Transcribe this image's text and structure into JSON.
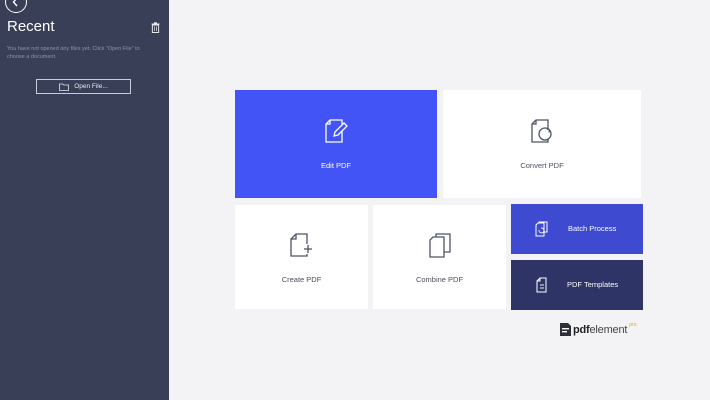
{
  "sidebar": {
    "title": "Recent",
    "empty_message": "You have not opened any files yet. Click \"Open File\" to choose a document.",
    "open_file_label": "Open File..."
  },
  "tiles": {
    "edit": "Edit PDF",
    "convert": "Convert PDF",
    "create": "Create PDF",
    "combine": "Combine PDF",
    "batch": "Batch Process",
    "templates": "PDF Templates"
  },
  "brand": {
    "name_bold": "pdf",
    "name_light": "element",
    "tier": "pro"
  },
  "colors": {
    "sidebar_bg": "#3a3f58",
    "accent_blue": "#4254f6",
    "batch_blue": "#3e4ad0",
    "templates_navy": "#2e3566",
    "background": "#f3f3f5"
  },
  "icons": {
    "back": "back-arrow-icon",
    "trash": "trash-icon",
    "folder": "folder-icon",
    "edit": "edit-document-icon",
    "convert": "convert-document-icon",
    "create": "create-document-icon",
    "combine": "combine-documents-icon",
    "batch": "batch-process-icon",
    "templates": "template-document-icon"
  }
}
